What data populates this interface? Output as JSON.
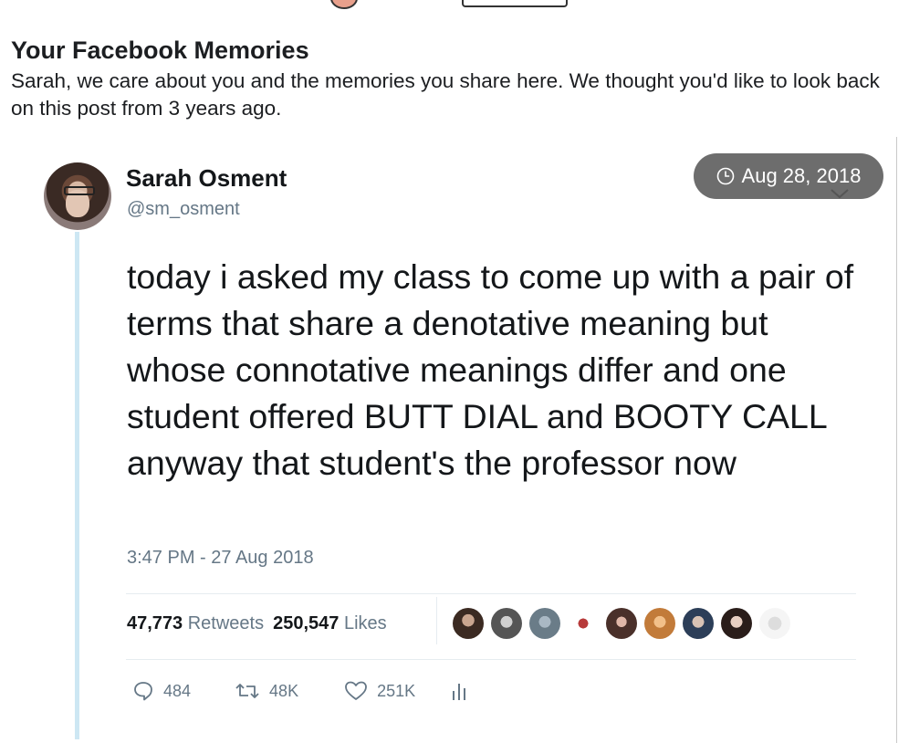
{
  "memories": {
    "title": "Your Facebook Memories",
    "message": "Sarah, we care about you and the memories you share here. We thought you'd like to look back on this post from 3 years ago."
  },
  "post_date": "Aug 28, 2018",
  "tweet": {
    "author_name": "Sarah Osment",
    "author_handle": "@sm_osment",
    "text": "today i asked my class to come up with a pair of terms that share a denotative meaning but whose connotative meanings differ and one student offered BUTT DIAL and BOOTY CALL anyway that student's the professor now",
    "timestamp": "3:47 PM - 27 Aug 2018",
    "retweets_count": "47,773",
    "retweets_label": "Retweets",
    "likes_count": "250,547",
    "likes_label": "Likes",
    "reply_count": "484",
    "retweet_action_count": "48K",
    "like_action_count": "251K"
  },
  "colors": {
    "thread_line": "#cde7f3",
    "date_pill": "#6d6d6d",
    "muted_text": "#657786"
  },
  "icons": [
    "clock-icon",
    "chevron-down-icon",
    "reply-icon",
    "retweet-icon",
    "heart-icon",
    "analytics-icon"
  ]
}
